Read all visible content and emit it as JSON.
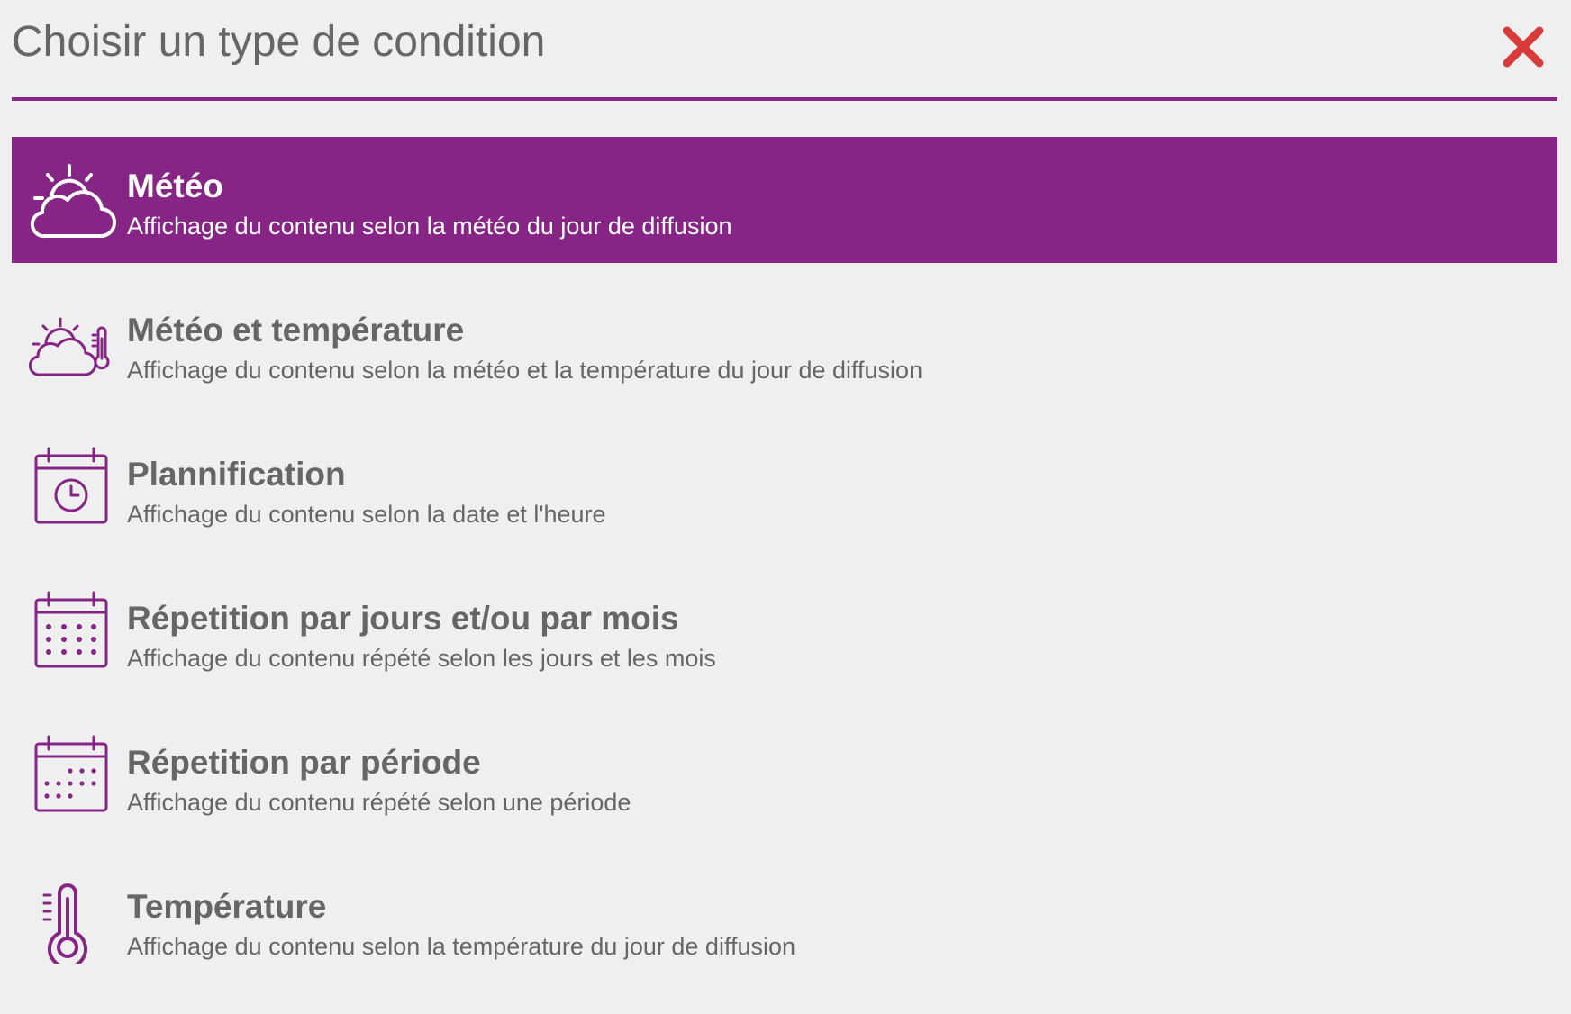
{
  "dialog": {
    "title": "Choisir un type de condition",
    "close_icon": "close-icon"
  },
  "colors": {
    "accent": "#862586",
    "text": "#666666",
    "background": "#efefef",
    "close": "#d93a3a",
    "selected_text": "#ffffff"
  },
  "conditions": [
    {
      "label": "Météo",
      "description": "Affichage du contenu selon la météo du jour de diffusion",
      "icon": "weather-icon",
      "selected": true
    },
    {
      "label": "Météo et température",
      "description": "Affichage du contenu selon la météo et la température du jour de diffusion",
      "icon": "weather-temperature-icon",
      "selected": false
    },
    {
      "label": "Plannification",
      "description": "Affichage du contenu selon la date et l'heure",
      "icon": "calendar-clock-icon",
      "selected": false
    },
    {
      "label": "Répetition par jours et/ou par mois",
      "description": "Affichage du contenu répété selon les jours et les mois",
      "icon": "calendar-grid-icon",
      "selected": false
    },
    {
      "label": "Répetition par période",
      "description": "Affichage du contenu répété selon une période",
      "icon": "calendar-period-icon",
      "selected": false
    },
    {
      "label": "Température",
      "description": "Affichage du contenu selon la température du jour de diffusion",
      "icon": "thermometer-icon",
      "selected": false
    }
  ]
}
